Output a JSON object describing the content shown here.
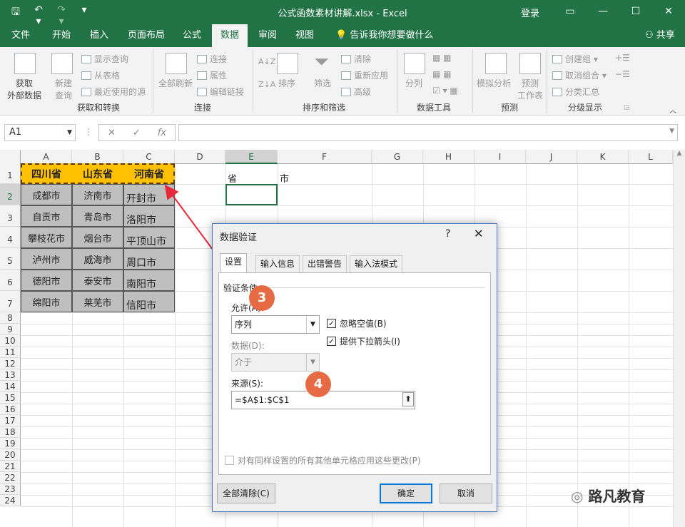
{
  "window": {
    "title": "公式函数素材讲解.xlsx - Excel",
    "login": "登录",
    "controls": [
      "▭",
      "—",
      "☐",
      "✕"
    ]
  },
  "qat": {
    "save": "🖫",
    "undo": "↶ ▾",
    "redo": "↷ ▾",
    "customize": "▾"
  },
  "tabs": [
    "文件",
    "开始",
    "插入",
    "页面布局",
    "公式",
    "数据",
    "审阅",
    "视图"
  ],
  "active_tab": "数据",
  "tell_me": "告诉我你想要做什么",
  "share": "共享",
  "ribbon": {
    "get_external_data": "获取\n外部数据",
    "new_query": "新建\n查询",
    "show_queries": "显示查询",
    "from_table": "从表格",
    "recent_sources": "最近使用的源",
    "group_get_transform": "获取和转换",
    "refresh_all": "全部刷新",
    "connections": "连接",
    "properties": "属性",
    "edit_links": "编辑链接",
    "group_connections": "连接",
    "sort": "排序",
    "filter": "筛选",
    "clear": "清除",
    "reapply": "重新应用",
    "advanced": "高级",
    "group_sort_filter": "排序和筛选",
    "text_to_columns": "分列",
    "group_data_tools": "数据工具",
    "what_if": "模拟分析",
    "forecast_sheet": "预测\n工作表",
    "group_forecast": "预测",
    "group": "创建组",
    "ungroup": "取消组合",
    "subtotal": "分类汇总",
    "group_outline": "分级显示"
  },
  "formula_bar": {
    "name_box": "A1",
    "fx": "fx",
    "cancel": "✕",
    "enter": "✓",
    "formula": ""
  },
  "columns": [
    "A",
    "B",
    "C",
    "D",
    "E",
    "F",
    "G",
    "H",
    "I",
    "J",
    "K",
    "L"
  ],
  "rows": [
    "1",
    "2",
    "3",
    "4",
    "5",
    "6",
    "7",
    "8",
    "9",
    "10",
    "11",
    "12",
    "13",
    "14",
    "15",
    "16",
    "17",
    "18",
    "19",
    "20",
    "21",
    "22",
    "23",
    "24"
  ],
  "sheet": {
    "headers": [
      "四川省",
      "山东省",
      "河南省"
    ],
    "col_a": [
      "成都市",
      "自贡市",
      "攀枝花市",
      "泸州市",
      "德阳市",
      "绵阳市"
    ],
    "col_b": [
      "济南市",
      "青岛市",
      "烟台市",
      "威海市",
      "泰安市",
      "莱芜市"
    ],
    "col_c": [
      "开封市",
      "洛阳市",
      "平顶山市",
      "周口市",
      "南阳市",
      "信阳市"
    ],
    "e1": "省",
    "f1": "市"
  },
  "dialog": {
    "title": "数据验证",
    "help": "?",
    "close": "✕",
    "tabs": [
      "设置",
      "输入信息",
      "出错警告",
      "输入法模式"
    ],
    "section": "验证条件",
    "allow_label": "允许(A):",
    "allow_value": "序列",
    "data_label": "数据(D):",
    "data_value": "介于",
    "ignore_blank": "忽略空值(B)",
    "dropdown": "提供下拉箭头(I)",
    "source_label": "来源(S):",
    "source_value": "=$A$1:$C$1",
    "apply_all": "对有同样设置的所有其他单元格应用这些更改(P)",
    "clear_all": "全部清除(C)",
    "ok": "确定",
    "cancel": "取消"
  },
  "annotations": {
    "step3": "3",
    "step4": "4",
    "accent": "#e66a44"
  },
  "watermark": "路凡教育"
}
